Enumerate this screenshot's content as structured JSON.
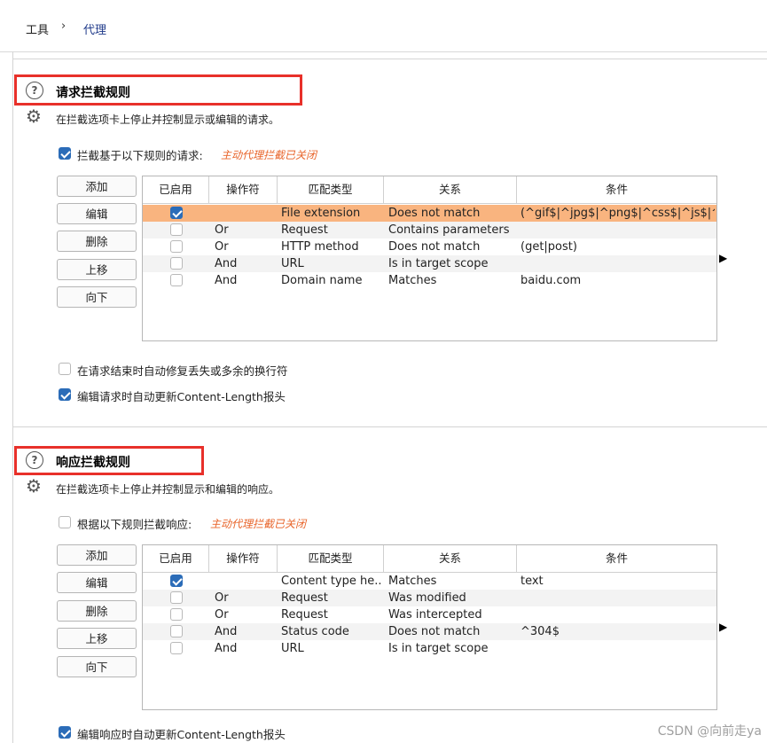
{
  "breadcrumb": {
    "tools": "工具",
    "separator": "›",
    "proxy": "代理"
  },
  "request_section": {
    "title": "请求拦截规则",
    "description": "在拦截选项卡上停止并控制显示或编辑的请求。",
    "intercept_checkbox": {
      "label": "拦截基于以下规则的请求:",
      "checked": true
    },
    "status_note": "主动代理拦截已关闭",
    "buttons": [
      "添加",
      "编辑",
      "删除",
      "上移",
      "向下"
    ],
    "columns": [
      "已启用",
      "操作符",
      "匹配类型",
      "关系",
      "条件"
    ],
    "rules": [
      {
        "enabled": true,
        "operator": "",
        "match_type": "File extension",
        "relationship": "Does not match",
        "condition": "(^gif$|^jpg$|^png$|^css$|^js$|^...",
        "selected": true
      },
      {
        "enabled": false,
        "operator": "Or",
        "match_type": "Request",
        "relationship": "Contains parameters",
        "condition": ""
      },
      {
        "enabled": false,
        "operator": "Or",
        "match_type": "HTTP method",
        "relationship": "Does not match",
        "condition": "(get|post)"
      },
      {
        "enabled": false,
        "operator": "And",
        "match_type": "URL",
        "relationship": "Is in target scope",
        "condition": ""
      },
      {
        "enabled": false,
        "operator": "And",
        "match_type": "Domain name",
        "relationship": "Matches",
        "condition": "baidu.com"
      }
    ],
    "option_fix_newlines": {
      "label": "在请求结束时自动修复丢失或多余的换行符",
      "checked": false
    },
    "option_update_length": {
      "label": "编辑请求时自动更新Content-Length报头",
      "checked": true
    }
  },
  "response_section": {
    "title": "响应拦截规则",
    "description": "在拦截选项卡上停止并控制显示和编辑的响应。",
    "intercept_checkbox": {
      "label": "根据以下规则拦截响应:",
      "checked": false
    },
    "status_note": "主动代理拦截已关闭",
    "buttons": [
      "添加",
      "编辑",
      "删除",
      "上移",
      "向下"
    ],
    "columns": [
      "已启用",
      "操作符",
      "匹配类型",
      "关系",
      "条件"
    ],
    "rules": [
      {
        "enabled": true,
        "operator": "",
        "match_type": "Content type he...",
        "relationship": "Matches",
        "condition": "text"
      },
      {
        "enabled": false,
        "operator": "Or",
        "match_type": "Request",
        "relationship": "Was modified",
        "condition": ""
      },
      {
        "enabled": false,
        "operator": "Or",
        "match_type": "Request",
        "relationship": "Was intercepted",
        "condition": ""
      },
      {
        "enabled": false,
        "operator": "And",
        "match_type": "Status code",
        "relationship": "Does not match",
        "condition": "^304$"
      },
      {
        "enabled": false,
        "operator": "And",
        "match_type": "URL",
        "relationship": "Is in target scope",
        "condition": ""
      }
    ],
    "option_update_length": {
      "label": "编辑响应时自动更新Content-Length报头",
      "checked": true
    }
  },
  "icons": {
    "help": "help-circle-icon",
    "settings": "gear-icon",
    "expand": "triangle-right-icon"
  },
  "colors": {
    "accent": "#2b6cb8",
    "selection": "#f9b47f",
    "highlight_box": "#e8302a",
    "status_note": "#e8642a"
  },
  "watermark": "CSDN @向前走ya"
}
